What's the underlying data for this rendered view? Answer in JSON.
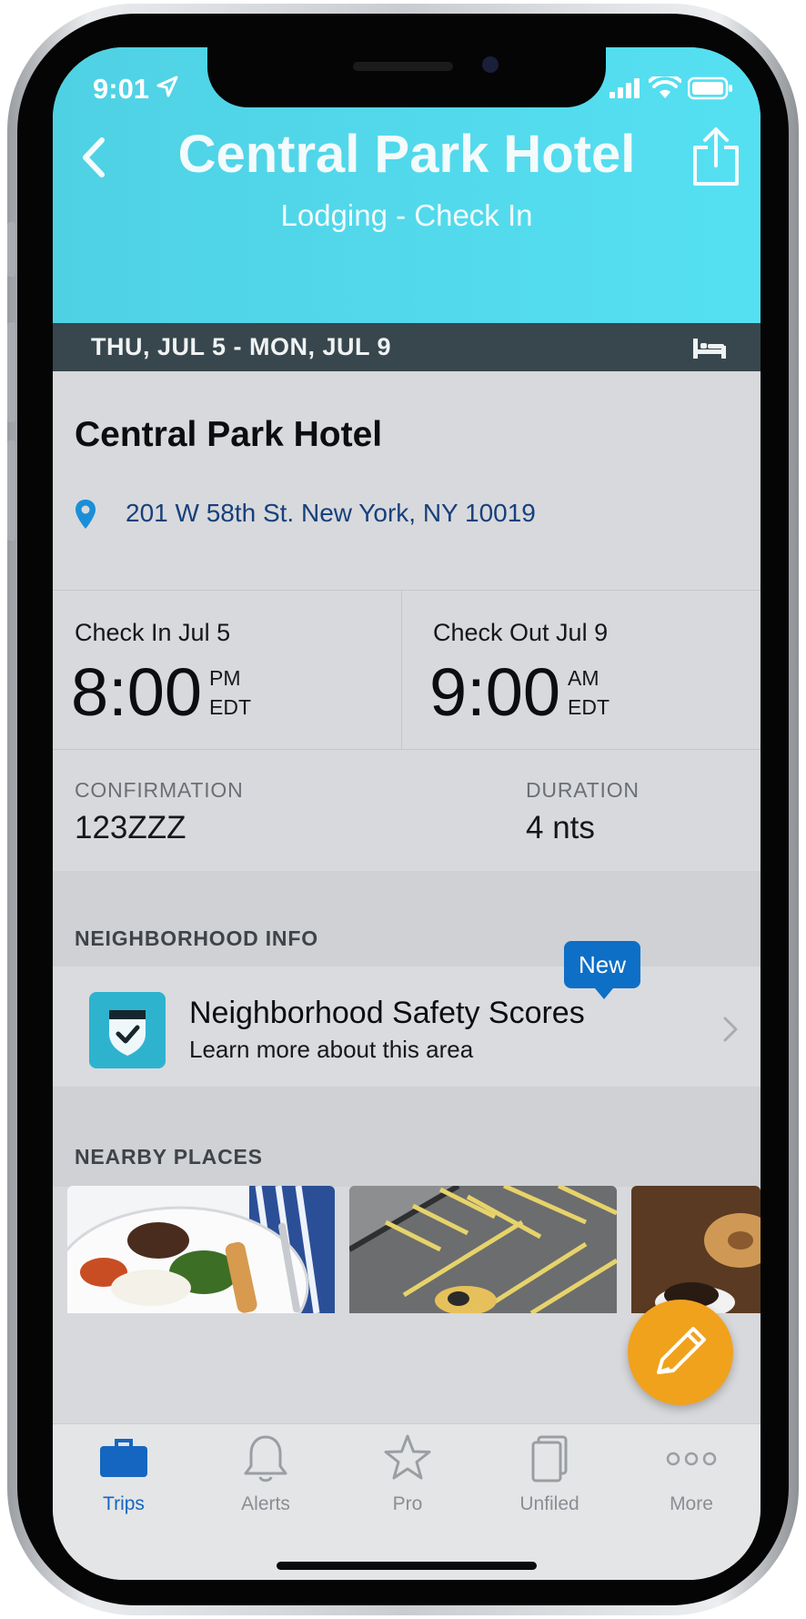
{
  "status": {
    "time": "9:01"
  },
  "header": {
    "title": "Central Park Hotel",
    "subtitle": "Lodging - Check In",
    "color": "#55DCEF"
  },
  "date_bar": {
    "dates": "THU, JUL 5 - MON, JUL 9",
    "icon": "bed-icon"
  },
  "hotel": {
    "name": "Central Park Hotel",
    "address": "201 W 58th St. New York, NY 10019"
  },
  "check_in": {
    "label": "Check In Jul 5",
    "time": "8:00",
    "ampm": "PM",
    "tz": "EDT"
  },
  "check_out": {
    "label": "Check Out Jul 9",
    "time": "9:00",
    "ampm": "AM",
    "tz": "EDT"
  },
  "confirmation": {
    "label": "CONFIRMATION",
    "value": "123ZZZ"
  },
  "duration": {
    "label": "DURATION",
    "value": "4 nts"
  },
  "neighborhood": {
    "section_title": "NEIGHBORHOOD INFO",
    "title": "Neighborhood Safety Scores",
    "subtitle": "Learn more about this area",
    "badge": "New"
  },
  "nearby": {
    "section_title": "NEARBY PLACES",
    "thumbnails": [
      "breakfast plate",
      "parking lot",
      "coffee and pastry"
    ]
  },
  "fab": {
    "icon": "pencil-icon",
    "color": "#F0A21D"
  },
  "tabs": [
    {
      "label": "Trips",
      "icon": "briefcase-icon",
      "active": true
    },
    {
      "label": "Alerts",
      "icon": "bell-icon",
      "active": false
    },
    {
      "label": "Pro",
      "icon": "star-icon",
      "active": false
    },
    {
      "label": "Unfiled",
      "icon": "documents-icon",
      "active": false
    },
    {
      "label": "More",
      "icon": "more-dots-icon",
      "active": false
    }
  ]
}
